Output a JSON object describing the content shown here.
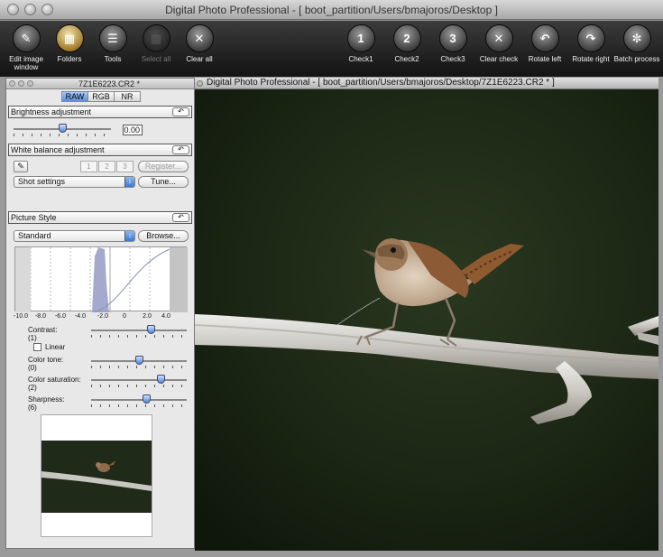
{
  "window": {
    "title": "Digital Photo Professional - [ boot_partition/Users/bmajoros/Desktop ]"
  },
  "toolbar": {
    "buttons": [
      {
        "label": "Edit image window",
        "icon": "edit-image-icon"
      },
      {
        "label": "Folders",
        "icon": "folders-icon"
      },
      {
        "label": "Tools",
        "icon": "tools-icon"
      },
      {
        "label": "Select all",
        "icon": "select-all-icon",
        "disabled": true
      },
      {
        "label": "Clear all",
        "icon": "clear-all-icon"
      },
      {
        "label": "Check1",
        "icon": "check1-icon",
        "glyph": "1"
      },
      {
        "label": "Check2",
        "icon": "check2-icon",
        "glyph": "2"
      },
      {
        "label": "Check3",
        "icon": "check3-icon",
        "glyph": "3"
      },
      {
        "label": "Clear check",
        "icon": "clear-check-icon"
      },
      {
        "label": "Rotate left",
        "icon": "rotate-left-icon"
      },
      {
        "label": "Rotate right",
        "icon": "rotate-right-icon"
      },
      {
        "label": "Batch process",
        "icon": "batch-process-icon"
      }
    ]
  },
  "panel": {
    "filename": "7Z1E6223.CR2 *",
    "tabs": [
      "RAW",
      "RGB",
      "NR"
    ],
    "active_tab": "RAW",
    "brightness": {
      "title": "Brightness adjustment",
      "value": "0.00",
      "level": 0.5
    },
    "white_balance": {
      "title": "White balance adjustment",
      "presets": [
        "1",
        "2",
        "3"
      ],
      "register_label": "Register...",
      "mode": "Shot settings",
      "tune_label": "Tune..."
    },
    "picture_style": {
      "title": "Picture Style",
      "style": "Standard",
      "browse_label": "Browse...",
      "histogram_ticks": [
        "-10.0",
        "-8.0",
        "-6.0",
        "-4.0",
        "-2.0",
        "0",
        "2.0",
        "4.0"
      ],
      "linear_label": "Linear",
      "linear_checked": false,
      "sliders": [
        {
          "label": "Contrast:",
          "value": "(1)",
          "level": 0.62
        },
        {
          "label": "Color tone:",
          "value": "(0)",
          "level": 0.5
        },
        {
          "label": "Color saturation:",
          "value": "(2)",
          "level": 0.73
        },
        {
          "label": "Sharpness:",
          "value": "(6)",
          "level": 0.58
        }
      ]
    }
  },
  "image_window": {
    "title": "Digital Photo Professional - [ boot_partition/Users/bmajoros/Desktop/7Z1E6223.CR2 * ]"
  },
  "colors": {
    "photo_background": "#1c2616",
    "accent_blue": "#4d86d8"
  }
}
